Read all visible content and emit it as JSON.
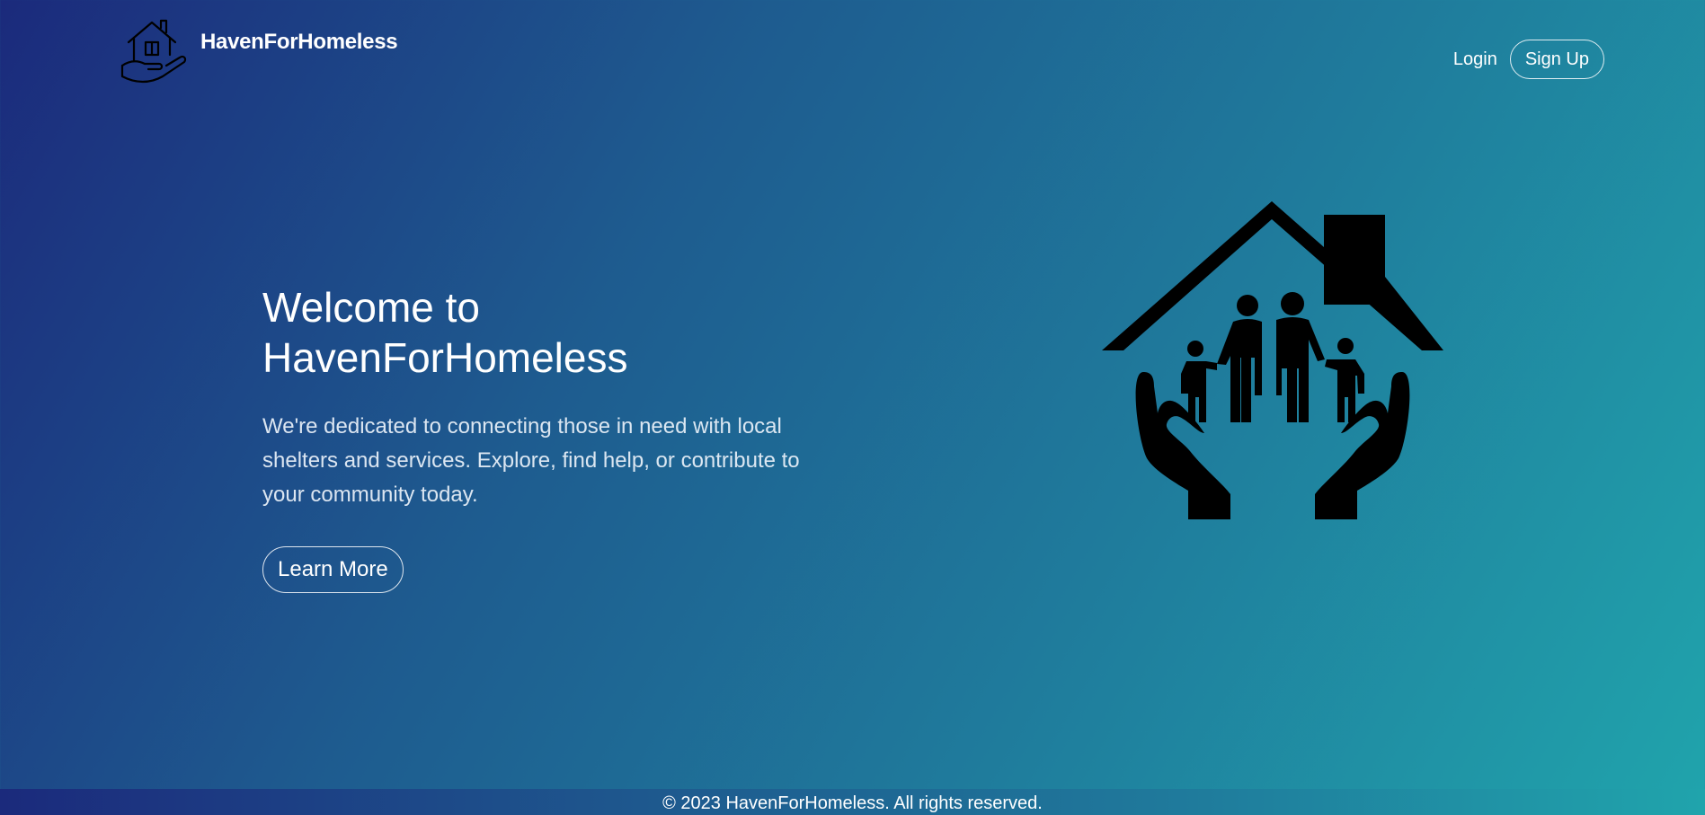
{
  "brand": {
    "name": "HavenForHomeless",
    "logo_icon": "house-in-hand-icon"
  },
  "nav": {
    "login_label": "Login",
    "signup_label": "Sign Up"
  },
  "hero": {
    "title_line1": "Welcome to",
    "title_line2": "HavenForHomeless",
    "description": "We're dedicated to connecting those in need with local shelters and services. Explore, find help, or contribute to your community today.",
    "cta_label": "Learn More",
    "illustration_icon": "family-house-hands-icon"
  },
  "footer": {
    "copyright": "© 2023 HavenForHomeless. All rights reserved."
  },
  "colors": {
    "gradient_start": "#1b2a7c",
    "gradient_mid": "#1f7b9c",
    "gradient_end": "#20a4ac",
    "text": "#ffffff",
    "illustration": "#000000"
  }
}
